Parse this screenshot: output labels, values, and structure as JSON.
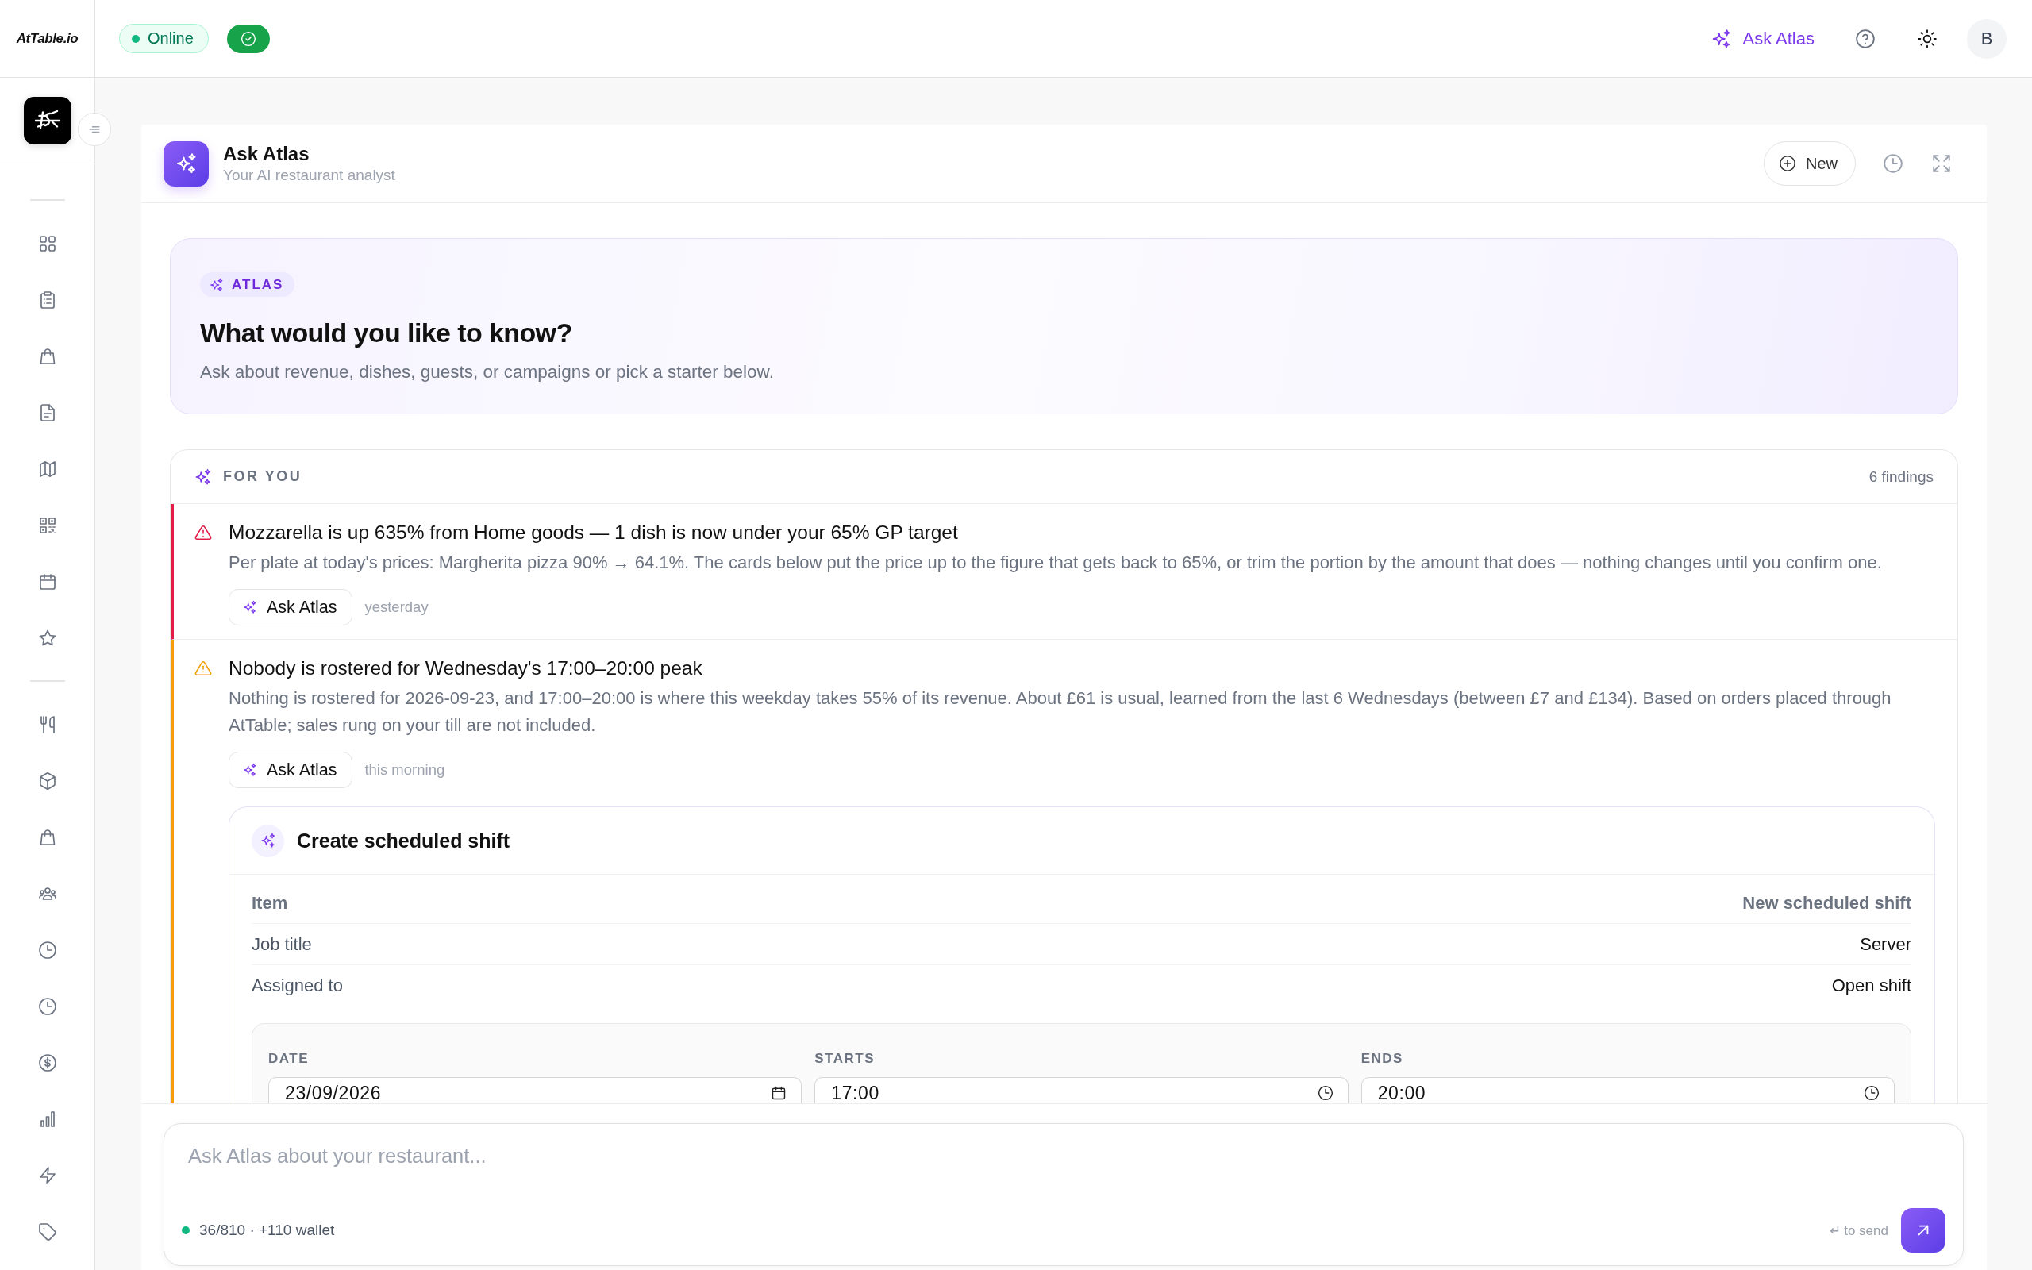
{
  "topbar": {
    "logo": "AtTable.io",
    "status": "Online",
    "ask_link": "Ask Atlas",
    "avatar": "B"
  },
  "panel": {
    "title": "Ask Atlas",
    "subtitle": "Your AI restaurant analyst",
    "new_button": "New"
  },
  "hero": {
    "badge": "ATLAS",
    "heading": "What would you like to know?",
    "text": "Ask about revenue, dishes, guests, or campaigns or pick a starter below."
  },
  "for_you": {
    "title": "FOR YOU",
    "count": "6 findings",
    "findings": [
      {
        "kind": "critical",
        "title": "Mozzarella is up 635% from Home goods — 1 dish is now under your 65% GP target",
        "body": "Per plate at today's prices: Margherita pizza 90% → 64.1%. The cards below put the price up to the figure that gets back to 65%, or trim the portion by the amount that does — nothing changes until you confirm one.",
        "action": "Ask Atlas",
        "time": "yesterday"
      },
      {
        "kind": "warning",
        "title": "Nobody is rostered for Wednesday's 17:00–20:00 peak",
        "body": "Nothing is rostered for 2026-09-23, and 17:00–20:00 is where this weekday takes 55% of its revenue. About £61 is usual, learned from the last 6 Wednesdays (between £7 and £134). Based on orders placed through AtTable; sales rung on your till are not included.",
        "action": "Ask Atlas",
        "time": "this morning",
        "proposal": {
          "title": "Create scheduled shift",
          "rows": [
            {
              "kind": "heading",
              "label": "Item",
              "value": "New scheduled shift"
            },
            {
              "kind": "detail",
              "label": "Job title",
              "value": "Server"
            },
            {
              "kind": "detail",
              "label": "Assigned to",
              "value": "Open shift"
            }
          ],
          "fields": [
            {
              "kind": "date",
              "label": "DATE",
              "value": "23/09/2026"
            },
            {
              "kind": "time",
              "label": "STARTS",
              "value": "17:00"
            },
            {
              "kind": "time",
              "label": "ENDS",
              "value": "20:00"
            }
          ]
        }
      }
    ]
  },
  "composer": {
    "placeholder": "Ask Atlas about your restaurant...",
    "usage": "36/810 · +110 wallet",
    "hint": "↵ to send"
  }
}
